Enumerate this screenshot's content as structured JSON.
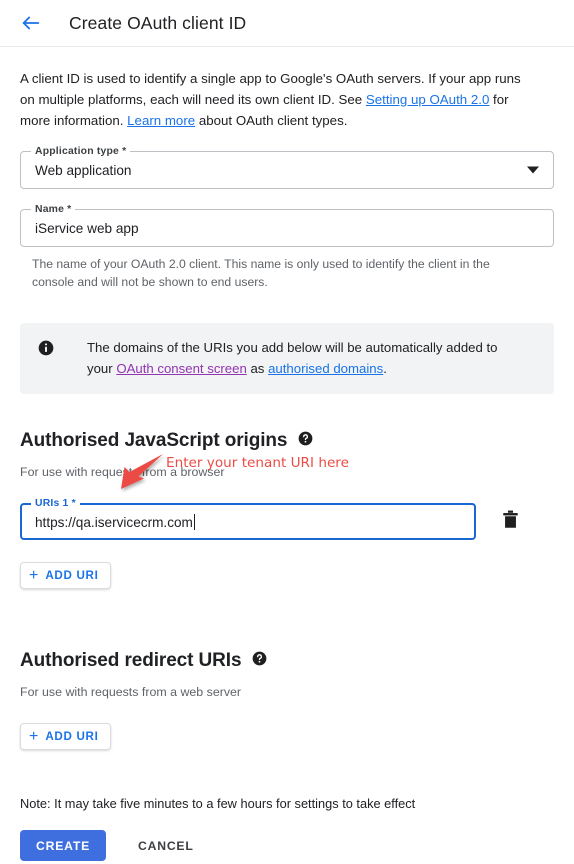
{
  "header": {
    "back_icon": "arrow-left-icon",
    "title": "Create OAuth client ID"
  },
  "intro": {
    "part1": "A client ID is used to identify a single app to Google's OAuth servers. If your app runs on multiple platforms, each will need its own client ID. See ",
    "link1": "Setting up OAuth 2.0",
    "part2": " for more information. ",
    "link2": "Learn more",
    "part3": " about OAuth client types."
  },
  "application_type": {
    "label": "Application type *",
    "value": "Web application",
    "caret_icon": "chevron-down-icon"
  },
  "name_field": {
    "label": "Name *",
    "value": "iService web app",
    "helper": "The name of your OAuth 2.0 client. This name is only used to identify the client in the console and will not be shown to end users."
  },
  "banner": {
    "icon": "info-icon",
    "part1": "The domains of the URIs you add below will be automatically added to your ",
    "link1": "OAuth consent screen",
    "part2": " as ",
    "link2": "authorised domains",
    "part3": "."
  },
  "js_origins": {
    "title": "Authorised JavaScript origins",
    "help_icon": "help-circle-icon",
    "subtitle": "For use with requests from a browser",
    "uri_label": "URIs 1 *",
    "uri_value": "https://qa.iservicecrm.com",
    "delete_icon": "trash-icon",
    "add_label": "ADD URI",
    "add_icon": "plus-icon"
  },
  "redirect_uris": {
    "title": "Authorised redirect URIs",
    "help_icon": "help-circle-icon",
    "subtitle": "For use with requests from a web server",
    "add_label": "ADD URI",
    "add_icon": "plus-icon"
  },
  "footer": {
    "note": "Note: It may take five minutes to a few hours for settings to take effect",
    "create_label": "CREATE",
    "cancel_label": "CANCEL"
  },
  "annotation": {
    "text": "Enter your tenant URI here",
    "arrow_icon": "arrow-pointer-icon",
    "color": "#ec4c44"
  },
  "colors": {
    "accent_blue": "#1a73e8",
    "focus_blue": "#1967d2",
    "create_button": "#3f6fdf",
    "visited_link": "#9334b0",
    "banner_bg": "#f1f3f4",
    "muted_text": "#5f6368"
  }
}
